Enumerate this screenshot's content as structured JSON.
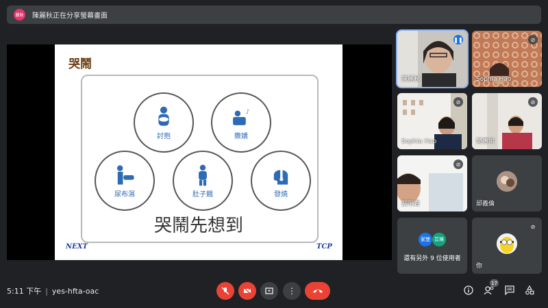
{
  "banner": {
    "chip_text": "麗秋",
    "text": "陳麗秋正在分享螢幕畫面"
  },
  "slide": {
    "title": "哭鬧",
    "items": [
      "討抱",
      "撒嬌",
      "尿布濕",
      "肚子餓",
      "發燒"
    ],
    "headline": "哭鬧先想到",
    "logo_left": "NEXT",
    "logo_right": "TCP"
  },
  "participants": [
    {
      "name": "陳麗秋",
      "state": "speaking"
    },
    {
      "name": "Sophia Hao",
      "state": "muted"
    },
    {
      "name": "Sophia Hao",
      "state": "muted"
    },
    {
      "name": "簡惠娟",
      "state": "muted"
    },
    {
      "name": "劉明君",
      "state": "muted"
    },
    {
      "name": "邱義倫",
      "state": "muted"
    },
    {
      "name": "還有另外 9 位使用者",
      "avatars": [
        "家慧",
        "苡琳"
      ]
    },
    {
      "name": "你",
      "state": "muted"
    }
  ],
  "bottom": {
    "time": "5:11 下午",
    "meeting_code": "yes-hfta-oac",
    "participant_count": "17"
  },
  "colors": {
    "end_call": "#ea4335",
    "speaking": "#1a73e8",
    "slide_icon": "#2e6bb3"
  }
}
